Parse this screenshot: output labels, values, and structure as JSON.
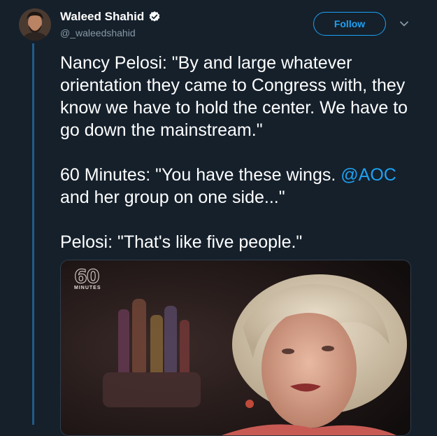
{
  "user": {
    "name": "Waleed Shahid",
    "handle": "@_waleedshahid",
    "verified": true
  },
  "actions": {
    "follow_label": "Follow",
    "more_icon": "chevron-down-icon"
  },
  "tweet": {
    "p1": "Nancy Pelosi: \"By and large whatever orientation they came to Congress with, they know we have to hold the center. We have to go down the mainstream.\"",
    "p2_prefix": "60 Minutes: \"You have these wings. ",
    "p2_mention": "@AOC",
    "p2_suffix": " and her group on one side...\"",
    "p3": "Pelosi: \"That's like five people.\""
  },
  "media": {
    "logo_number": "60",
    "logo_word": "MINUTES"
  },
  "colors": {
    "background": "#15202b",
    "accent": "#1da1f2",
    "muted": "#8899a6"
  }
}
